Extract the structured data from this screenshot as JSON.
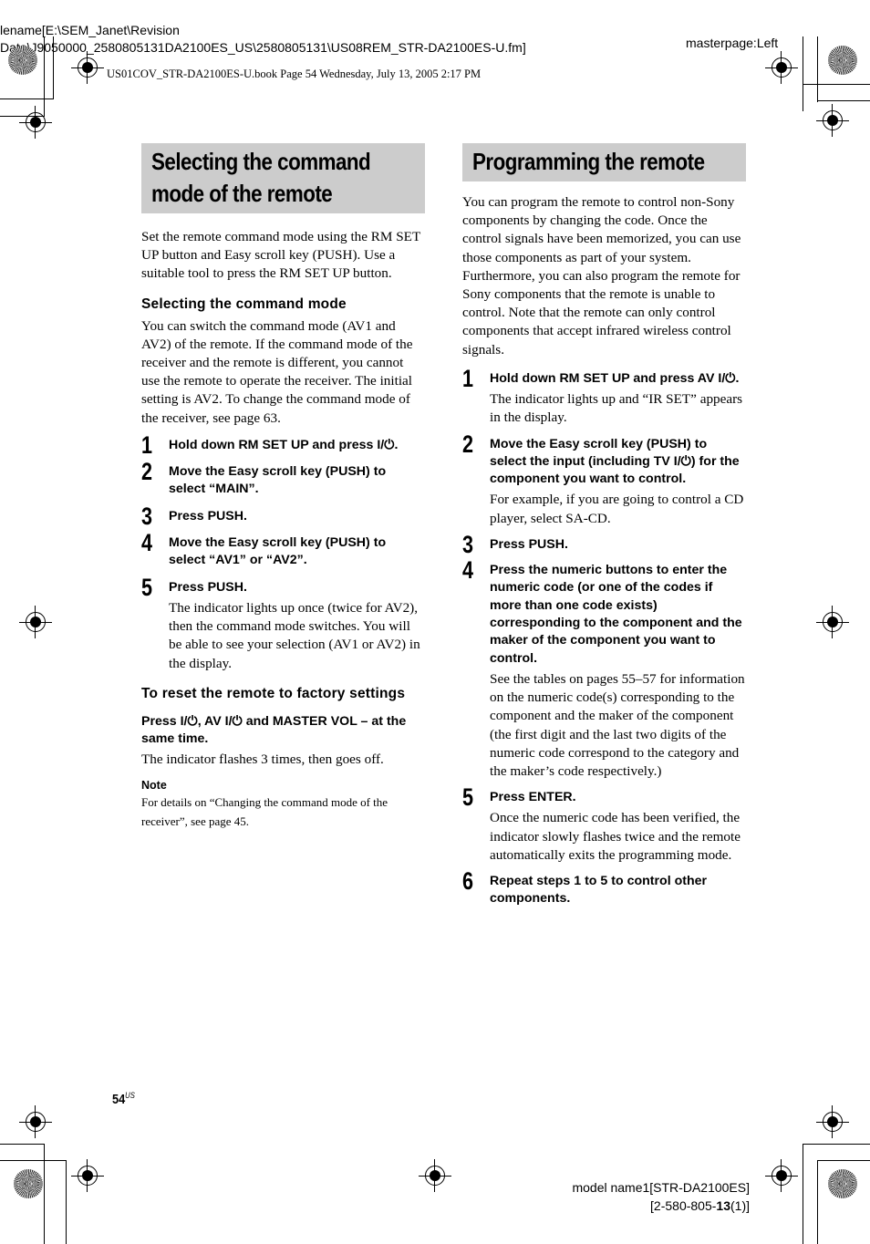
{
  "print_header": {
    "filename_line1": "lename[E:\\SEM_Janet\\Revision",
    "filename_line2": "Data\\J9050000_2580805131DA2100ES_US\\2580805131\\US08REM_STR-DA2100ES-U.fm]",
    "book_line": "US01COV_STR-DA2100ES-U.book  Page 54  Wednesday, July 13, 2005  2:17 PM",
    "masterpage": "masterpage:Left"
  },
  "left_column": {
    "title": [
      "Selecting the command",
      "mode of the remote"
    ],
    "intro": "Set the remote command mode using the RM SET UP button and Easy scroll key (PUSH). Use a suitable tool to press the RM SET UP button.",
    "subsection": {
      "heading": "Selecting the command mode",
      "body": "You can switch the command mode (AV1 and AV2) of the remote. If the command mode of the receiver and the remote is different, you cannot use the remote to operate the receiver. The initial setting is AV2. To change the command mode of the receiver, see page 63.",
      "steps": [
        {
          "num": "1",
          "head": "Hold down RM SET UP and press I/⏻.",
          "body": ""
        },
        {
          "num": "2",
          "head": "Move the Easy scroll key (PUSH) to select “MAIN”.",
          "body": ""
        },
        {
          "num": "3",
          "head": "Press PUSH.",
          "body": ""
        },
        {
          "num": "4",
          "head": "Move the Easy scroll key (PUSH) to select “AV1” or “AV2”.",
          "body": ""
        },
        {
          "num": "5",
          "head": "Press PUSH.",
          "body": "The indicator lights up once (twice for AV2), then the command mode switches. You will be able to see your selection (AV1 or  AV2) in the display."
        }
      ]
    },
    "reset": {
      "heading": "To reset the remote to factory settings",
      "instruction": "Press I/⏻, AV I/⏻ and MASTER VOL – at the same time.",
      "result": "The indicator flashes 3 times, then goes off."
    },
    "note": {
      "label": "Note",
      "text": "For details on “Changing the command mode of the receiver”, see page 45."
    }
  },
  "right_column": {
    "title": "Programming the remote",
    "intro_1": "You can program the remote to control non-Sony components by changing the code. Once the control signals have been memorized, you can use those components as part of your system.",
    "intro_2": "Furthermore, you can also program the remote for Sony components that the remote is unable to control. Note that the remote can only control components that accept infrared wireless control signals.",
    "steps": [
      {
        "num": "1",
        "head": "Hold down RM SET UP and press AV I/⏻.",
        "body": "The indicator lights up and “IR SET” appears in the display."
      },
      {
        "num": "2",
        "head": "Move the Easy scroll key (PUSH) to select the input (including TV I/⏻) for the component you want to control.",
        "body": "For example, if you are going to control a CD player, select SA-CD."
      },
      {
        "num": "3",
        "head": "Press PUSH.",
        "body": ""
      },
      {
        "num": "4",
        "head": "Press the numeric buttons to enter the numeric code (or one of the codes if more than one code exists) corresponding to the component and the maker of the component you want to control.",
        "body": "See the tables on pages 55–57 for information on the numeric code(s) corresponding to the component and the maker of the component (the first digit and the last two digits of the numeric code correspond to the category and the maker’s code respectively.)"
      },
      {
        "num": "5",
        "head": "Press ENTER.",
        "body": "Once the numeric code has been verified, the indicator slowly flashes twice and the remote automatically exits the programming mode."
      },
      {
        "num": "6",
        "head": "Repeat steps 1 to 5 to control other components.",
        "body": ""
      }
    ]
  },
  "footer": {
    "page_number": "54",
    "page_suffix": "US",
    "model_line1": "model name1[STR-DA2100ES]",
    "model_line2_prefix": "[2-580-805-",
    "model_line2_bold": "13",
    "model_line2_suffix": "(1)]"
  }
}
